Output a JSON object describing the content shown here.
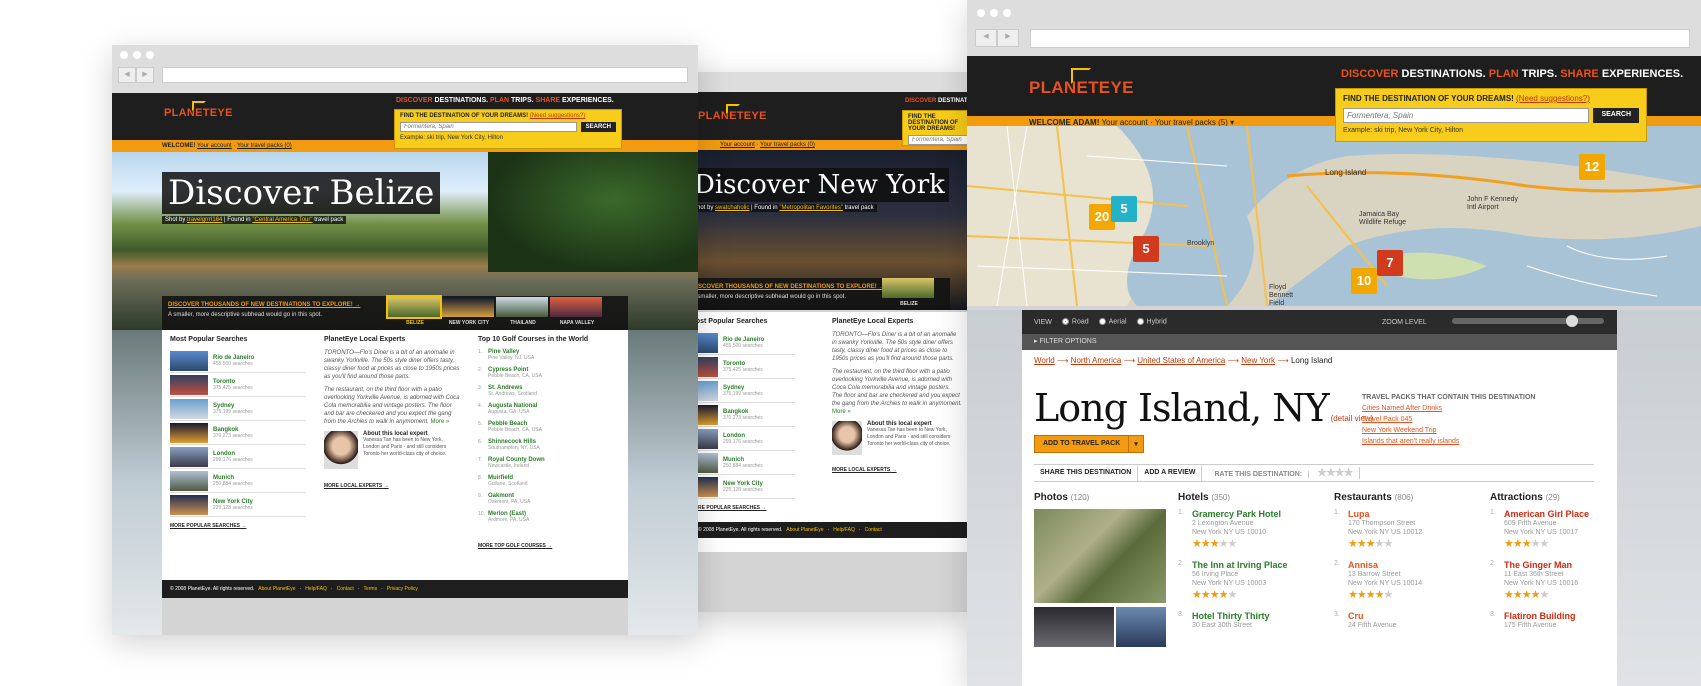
{
  "brand": {
    "logo": "PLANETEYE",
    "tagline_words": [
      "DISCOVER",
      "DESTINATIONS.",
      "PLAN",
      "TRIPS.",
      "SHARE",
      "EXPERIENCES."
    ],
    "find_label": "FIND THE DESTINATION OF YOUR DREAMS!",
    "need_suggestions": "(Need suggestions?)",
    "search_placeholder": "Formentera, Spain",
    "search_button": "SEARCH",
    "search_example": "Example: ski trip, New York City, Hilton",
    "orange": "#f29b10",
    "red": "#e8521e",
    "yellow": "#f5c200"
  },
  "window1": {
    "welcome": "WELCOME!",
    "your_account": "Your account",
    "your_travel_packs": "Your travel packs (0)",
    "hero_title": "Discover Belize",
    "shot_by_prefix": "Shot by",
    "shot_by_user": "travelgrrrl164",
    "found_in_prefix": "Found in",
    "found_in_pack": "\"Central America Tour\"",
    "found_in_suffix": "travel pack",
    "cta": "DISCOVER THOUSANDS OF NEW DESTINATIONS TO EXPLORE!",
    "subhead": "A smaller, more descriptive subhead would go in this spot.",
    "thumb_labels": [
      "BELIZE",
      "NEW YORK CITY",
      "THAILAND",
      "NAPA VALLEY"
    ],
    "popular_title": "Most Popular Searches",
    "popular": [
      {
        "name": "Rio de Janeiro",
        "count": "455,500 searches"
      },
      {
        "name": "Toronto",
        "count": "375,425 searches"
      },
      {
        "name": "Sydney",
        "count": "375,199 searches"
      },
      {
        "name": "Bangkok",
        "count": "370,273 searches"
      },
      {
        "name": "London",
        "count": "299,176 searches"
      },
      {
        "name": "Munich",
        "count": "250,884 searches"
      },
      {
        "name": "New York City",
        "count": "225,128 searches"
      }
    ],
    "more_popular": "MORE POPULAR SEARCHES",
    "experts_title": "PlanetEye Local Experts",
    "expert_p1": "TORONTO—Flo's Diner is a bit of an anomalie in swanky Yorkville. The 50s style diner offers tasty, classy diner food at prices as close to 1950s prices as you'll find around those parts.",
    "expert_p2": "The restaurant, on the third floor with a patio overlooking Yorkville Avenue, is adorned with Coca Cola memorabilia and vintage posters. The floor and bar are checkered and you expect the gang from the Archies to walk in anymoment.",
    "more_link": "More »",
    "about_expert_title": "About this local expert",
    "about_expert_text": "Vanessa Tan has been to New York, London and Paris - and still considers Toronto her world-class city of choice.",
    "more_experts": "MORE LOCAL EXPERTS",
    "golf_title": "Top 10 Golf Courses in the World",
    "golf": [
      {
        "n": "1.",
        "name": "Pine Valley",
        "loc": "Pine Valley, NJ, USA"
      },
      {
        "n": "2.",
        "name": "Cypress Point",
        "loc": "Pebble Beach, CA, USA"
      },
      {
        "n": "3.",
        "name": "St. Andrews",
        "loc": "St. Andrews, Scotland"
      },
      {
        "n": "4.",
        "name": "Augusta National",
        "loc": "Augusta, GA, USA"
      },
      {
        "n": "5.",
        "name": "Pebble Beach",
        "loc": "Pebble Beach, CA, USA"
      },
      {
        "n": "6.",
        "name": "Shinnecock Hills",
        "loc": "Southampton, NY, USA"
      },
      {
        "n": "7.",
        "name": "Royal County Down",
        "loc": "Newcastle, Ireland"
      },
      {
        "n": "8.",
        "name": "Muirfield",
        "loc": "Gullane, Scotland"
      },
      {
        "n": "9.",
        "name": "Oakmont",
        "loc": "Oakmont, PA, USA"
      },
      {
        "n": "10.",
        "name": "Merion (East)",
        "loc": "Ardmore, PA, USA"
      }
    ],
    "more_golf": "MORE TOP GOLF COURSES",
    "footer_copy": "© 2008 PlanetEye. All rights reserved.",
    "footer_links": [
      "About PlanetEye",
      "Help/FAQ",
      "Contact",
      "Terms",
      "Privacy Policy"
    ]
  },
  "window2": {
    "hero_title": "Discover New York",
    "shot_by_user": "swatchaholic",
    "found_in_pack": "\"Metropolitan Favorites\"",
    "popular": [
      {
        "name": "Rio de Janeiro",
        "count": "455,500 searches"
      },
      {
        "name": "Toronto",
        "count": "375,425 searches"
      },
      {
        "name": "Sydney",
        "count": "375,199 searches"
      },
      {
        "name": "Bangkok",
        "count": "370,273 searches"
      },
      {
        "name": "London",
        "count": "299,176 searches"
      },
      {
        "name": "Munich",
        "count": "250,884 searches"
      },
      {
        "name": "New York City",
        "count": "225,128 searches"
      }
    ],
    "thumb_label": "BELIZE"
  },
  "window3": {
    "welcome": "WELCOME ADAM!",
    "your_account": "Your account",
    "your_travel_packs": "Your travel packs (5)",
    "map_markers": [
      {
        "num": "20",
        "color": "#f2a800"
      },
      {
        "num": "5",
        "color": "#23b3c9"
      },
      {
        "num": "5",
        "color": "#d23a1e"
      },
      {
        "num": "7",
        "color": "#d23a1e"
      },
      {
        "num": "10",
        "color": "#f2a800"
      },
      {
        "num": "12",
        "color": "#f2a800"
      }
    ],
    "map_labels": [
      "Long Island",
      "Jamaica Bay Wildlife Refuge",
      "John F Kennedy Intl Airport",
      "Brooklyn",
      "Floyd Bennett Field"
    ],
    "view_label": "VIEW",
    "view_options": [
      "Road",
      "Aerial",
      "Hybrid"
    ],
    "zoom_label": "ZOOM LEVEL",
    "filter_label": "FILTER OPTIONS",
    "breadcrumbs": [
      "World",
      "North America",
      "United States of America",
      "New York"
    ],
    "breadcrumb_current": "Long Island",
    "title": "Long Island, NY",
    "detail_view": "(detail view)",
    "add_btn": "ADD TO TRAVEL PACK",
    "packs_title": "TRAVEL PACKS THAT CONTAIN THIS DESTINATION",
    "packs": [
      "Cities Named After Drinks",
      "Travel Pack 045",
      "New York Weekend Trip",
      "Islands that aren't really islands"
    ],
    "share": "SHARE THIS DESTINATION",
    "review": "ADD A REVIEW",
    "rate": "RATE THIS DESTINATION:",
    "photos_title": "Photos",
    "photos_count": "(120)",
    "hotels_title": "Hotels",
    "hotels_count": "(350)",
    "hotels": [
      {
        "n": "1.",
        "name": "Gramercy Park Hotel",
        "a1": "2 Lexington Avenue",
        "a2": "New York NY US 10010",
        "rating": 3
      },
      {
        "n": "2.",
        "name": "The Inn at Irving Place",
        "a1": "56 Irving Place",
        "a2": "New York NY US 10003",
        "rating": 4
      },
      {
        "n": "3.",
        "name": "Hotel Thirty Thirty",
        "a1": "30 East 30th Street",
        "a2": "",
        "rating": 0
      }
    ],
    "restaurants_title": "Restaurants",
    "restaurants_count": "(806)",
    "restaurants": [
      {
        "n": "1.",
        "name": "Lupa",
        "a1": "170 Thompson Street",
        "a2": "New York NY US 10012",
        "rating": 3
      },
      {
        "n": "2.",
        "name": "Annisa",
        "a1": "13 Barrow Street",
        "a2": "New York NY US 10014",
        "rating": 4
      },
      {
        "n": "3.",
        "name": "Cru",
        "a1": "24 Fifth Avenue",
        "a2": "",
        "rating": 0
      }
    ],
    "attractions_title": "Attractions",
    "attractions_count": "(29)",
    "attractions": [
      {
        "n": "1.",
        "name": "American Girl Place",
        "a1": "609 Fifth Avenue",
        "a2": "New York NY US 10017",
        "rating": 3
      },
      {
        "n": "2.",
        "name": "The Ginger Man",
        "a1": "11 East 36th Street",
        "a2": "New York NY US 10016",
        "rating": 4
      },
      {
        "n": "3.",
        "name": "Flatiron Building",
        "a1": "175 Fifth Avenue",
        "a2": "",
        "rating": 0
      }
    ]
  }
}
